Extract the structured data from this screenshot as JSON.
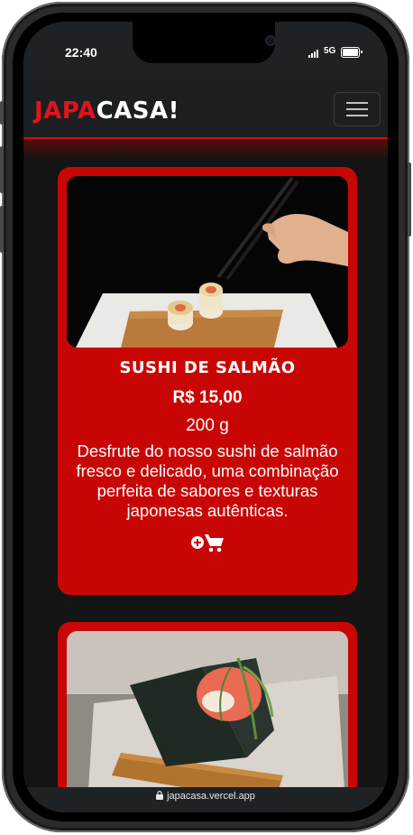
{
  "status": {
    "time": "22:40",
    "network": "5G"
  },
  "navbar": {
    "brand_part1": "JAPA",
    "brand_part2": "CASA!",
    "brand_accent": "#e3121b"
  },
  "products": [
    {
      "title": "SUSHI DE SALMÃO",
      "price": "R$ 15,00",
      "weight": "200 g",
      "description": "Desfrute do nosso sushi de salmão fresco e delicado, uma combinação perfeita de sabores e texturas japonesas autênticas.",
      "add_icon": "add-to-cart-icon"
    },
    {
      "title": "",
      "price": "",
      "weight": "",
      "description": "",
      "add_icon": "add-to-cart-icon"
    }
  ],
  "browser": {
    "url": "japacasa.vercel.app"
  },
  "colors": {
    "card_red": "#c90606",
    "background": "#141414",
    "navbar": "#1c1f22"
  }
}
